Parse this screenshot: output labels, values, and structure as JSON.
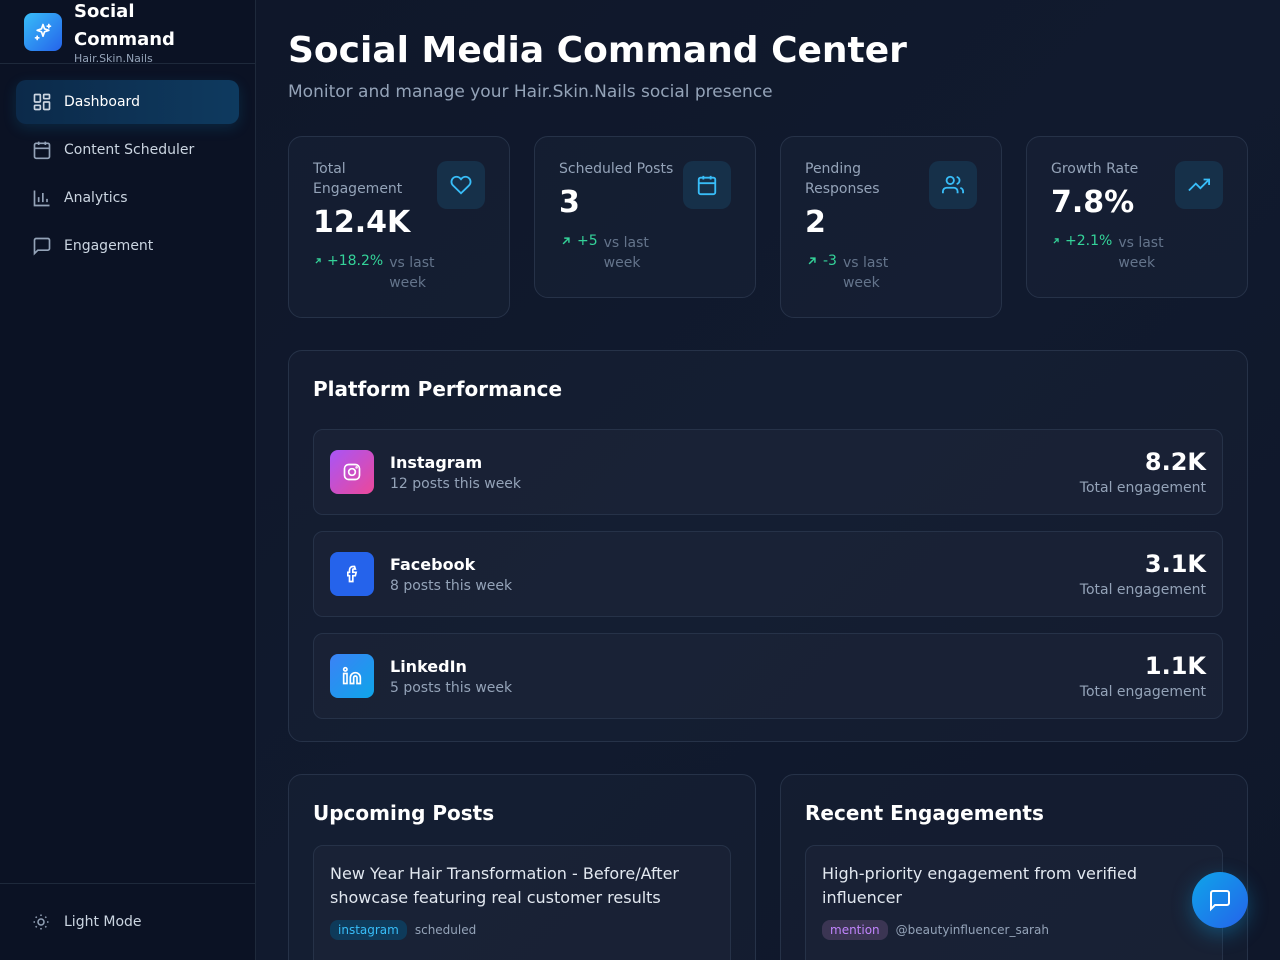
{
  "brand": {
    "name": "Social Command",
    "sub": "Hair.Skin.Nails"
  },
  "nav": [
    {
      "label": "Dashboard",
      "icon": "dashboard-icon",
      "active": true
    },
    {
      "label": "Content Scheduler",
      "icon": "calendar-icon"
    },
    {
      "label": "Analytics",
      "icon": "bar-chart-icon"
    },
    {
      "label": "Engagement",
      "icon": "message-icon"
    }
  ],
  "theme_toggle": {
    "label": "Light Mode",
    "icon": "sun-icon"
  },
  "header": {
    "title": "Social Media Command Center",
    "subtitle": "Monitor and manage your Hair.Skin.Nails social presence"
  },
  "stats": [
    {
      "label": "Total Engagement",
      "value": "12.4K",
      "delta": "+18.2%",
      "vs": "vs last week",
      "icon": "heart-icon"
    },
    {
      "label": "Scheduled Posts",
      "value": "3",
      "delta": "+5",
      "vs": "vs last week",
      "icon": "calendar-icon"
    },
    {
      "label": "Pending Responses",
      "value": "2",
      "delta": "-3",
      "vs": "vs last week",
      "icon": "users-icon"
    },
    {
      "label": "Growth Rate",
      "value": "7.8%",
      "delta": "+2.1%",
      "vs": "vs last week",
      "icon": "trending-up-icon"
    }
  ],
  "performance": {
    "title": "Platform Performance",
    "platforms": [
      {
        "name": "Instagram",
        "posts": "12 posts this week",
        "value": "8.2K",
        "label": "Total engagement",
        "icon": "instagram-icon"
      },
      {
        "name": "Facebook",
        "posts": "8 posts this week",
        "value": "3.1K",
        "label": "Total engagement",
        "icon": "facebook-icon"
      },
      {
        "name": "LinkedIn",
        "posts": "5 posts this week",
        "value": "1.1K",
        "label": "Total engagement",
        "icon": "linkedin-icon"
      }
    ]
  },
  "upcoming": {
    "title": "Upcoming Posts",
    "items": [
      {
        "text": "New Year Hair Transformation - Before/After showcase featuring real customer results",
        "tag": "instagram",
        "status": "scheduled"
      }
    ]
  },
  "engagements": {
    "title": "Recent Engagements",
    "items": [
      {
        "text": "High-priority engagement from verified influencer",
        "tag": "mention",
        "handle": "@beautyinfluencer_sarah"
      }
    ]
  },
  "colors": {
    "accent": "#0ea5e9",
    "positive": "#34d399",
    "background": "#0f172a"
  }
}
